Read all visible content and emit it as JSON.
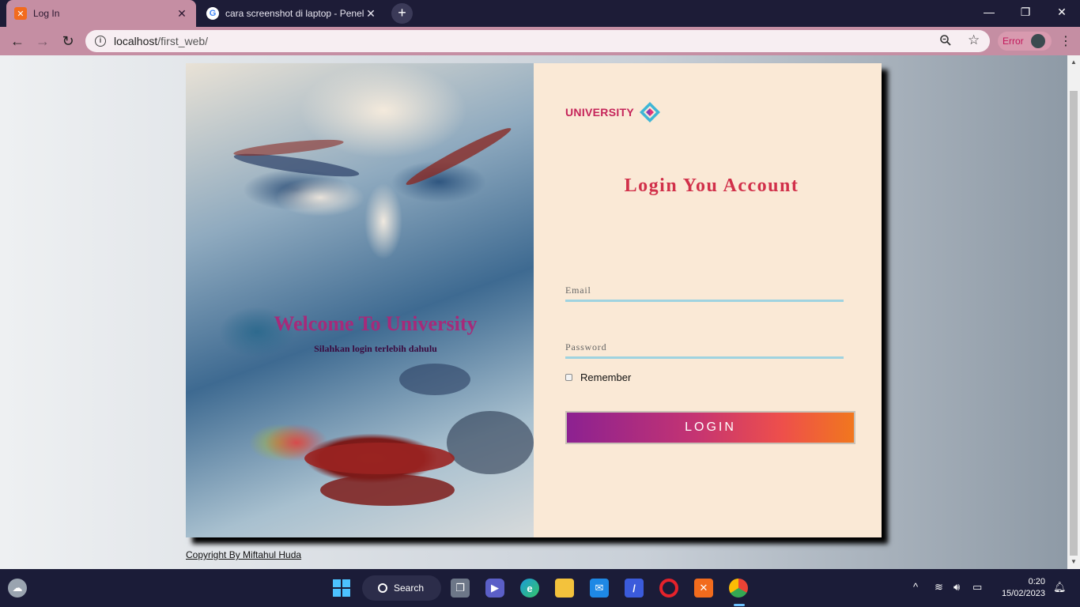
{
  "browser": {
    "tabs": [
      {
        "title": "Log In",
        "active": true
      },
      {
        "title": "cara screenshot di laptop - Peneli",
        "active": false
      }
    ],
    "new_tab": "+",
    "url_host": "localhost",
    "url_path": "/first_web/",
    "error_label": "Error",
    "window_controls": {
      "minimize": "—",
      "restore": "❐",
      "close": "✕"
    }
  },
  "page": {
    "welcome_title": "Welcome To University",
    "welcome_subtitle": "Silahkan login terlebih dahulu",
    "brand_name": "UNIVERSITY",
    "login_title": "Login You Account",
    "email_placeholder": "Email",
    "password_placeholder": "Password",
    "remember_label": "Remember",
    "login_button": "LOGIN",
    "copyright": "Copyright By Miftahul Huda"
  },
  "colors": {
    "panel_bg": "#fae9d6",
    "title_red": "#d1304a",
    "brand_pink": "#c5245a",
    "button_gradient": [
      "#8c2191",
      "#c53472",
      "#ee4f4b",
      "#f1771e"
    ],
    "underline_blue": "#9fd3e0"
  },
  "taskbar": {
    "search_label": "Search",
    "time": "0:20",
    "date": "15/02/2023"
  }
}
